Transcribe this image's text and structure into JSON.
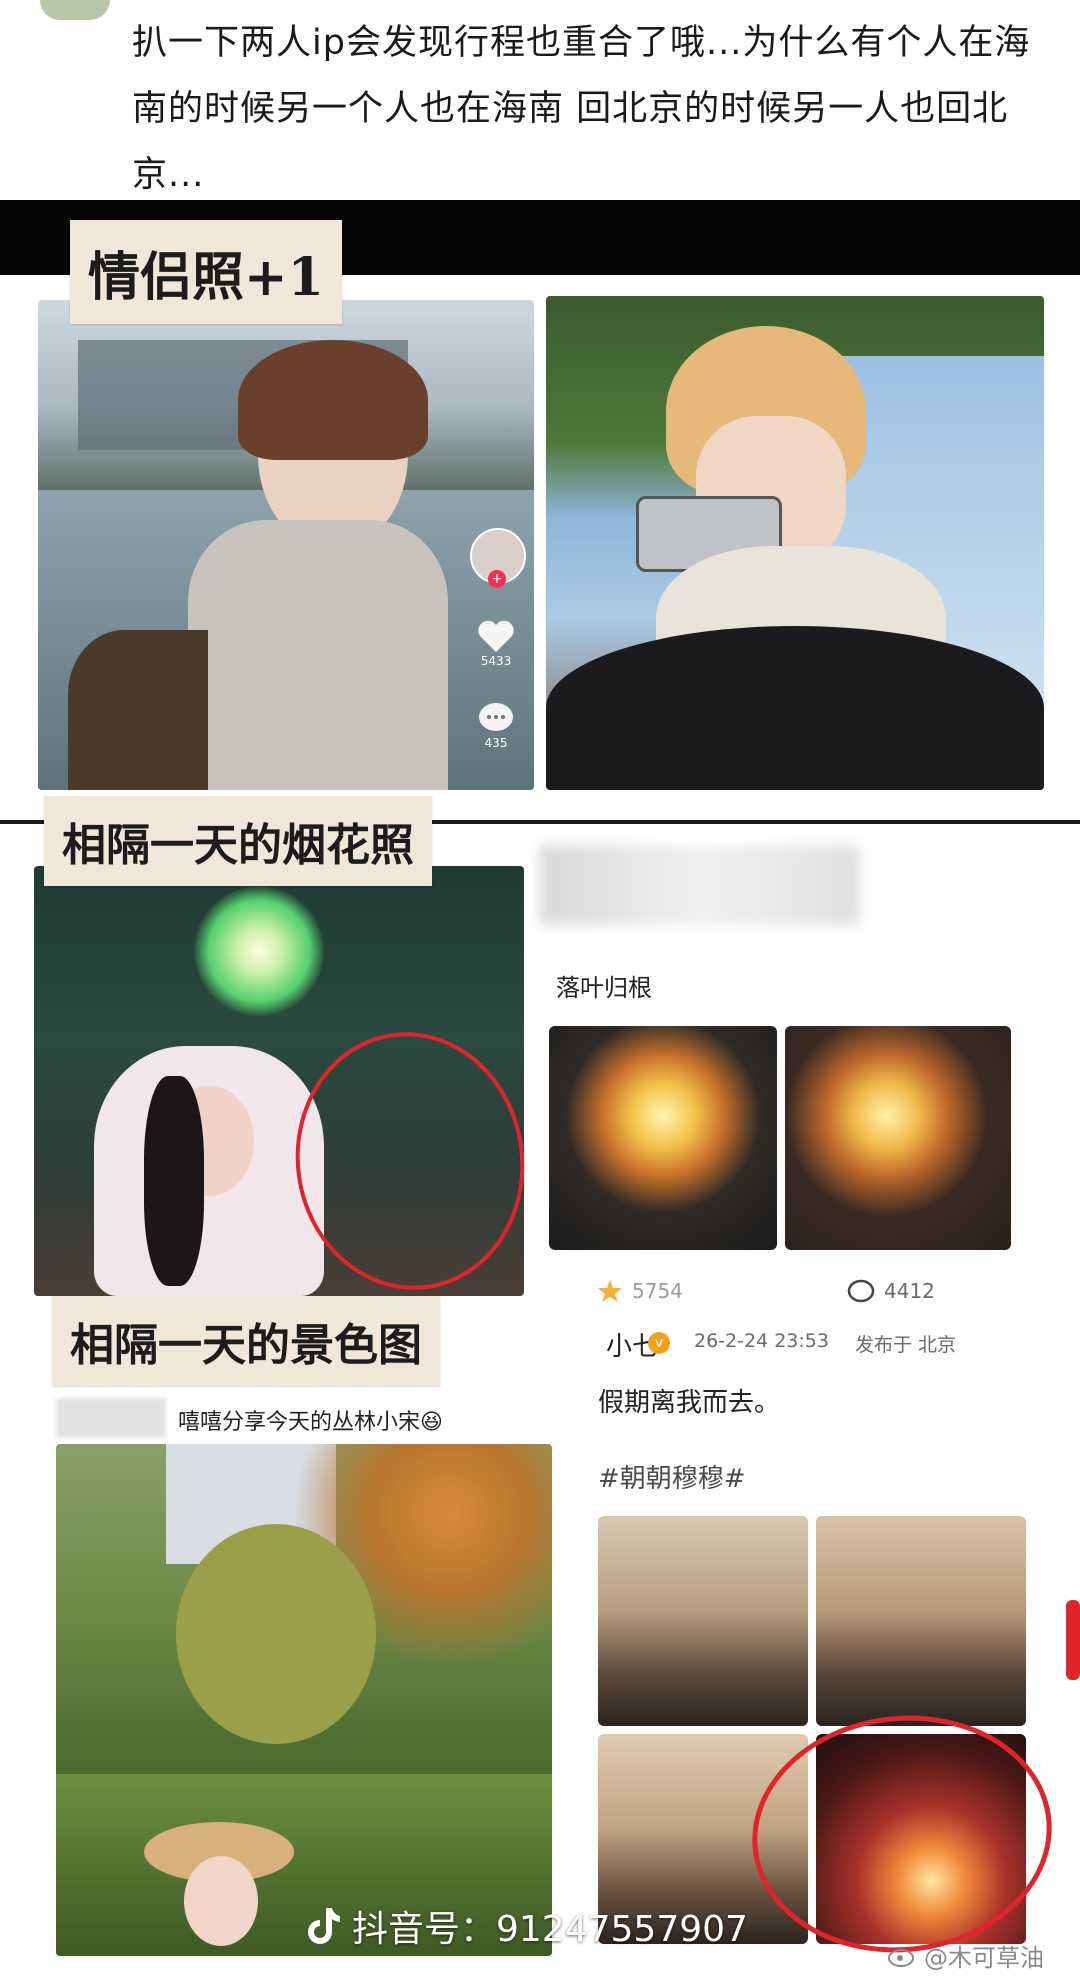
{
  "post": {
    "text": "扒一下两人ip会发现行程也重合了哦...为什么有个人在海南的时候另一个人也在海南 回北京的时候另一人也回北京..."
  },
  "sections": {
    "couple_photo": {
      "label": "情侣照+1"
    },
    "fireworks": {
      "label": "相隔一天的烟花照"
    },
    "scenery": {
      "label": "相隔一天的景色图"
    }
  },
  "tiktok_side": {
    "likes": "5433",
    "comments": "435"
  },
  "fireworks_post": {
    "caption": "落叶归根",
    "likes": "5754",
    "comments": "4412"
  },
  "scenery_left": {
    "caption": "嘻嘻分享今天的丛林小宋😆"
  },
  "scenery_right": {
    "username": "小七",
    "timestamp": "26-2-24 23:53",
    "location": "发布于 北京",
    "text": "假期离我而去。",
    "hashtag": "#朝朝穆穆#"
  },
  "watermarks": {
    "douyin": "抖音号：91247557907",
    "weibo": "@木可草油"
  },
  "colors": {
    "accent_red": "#e0242b",
    "tape_bg": "#efe7d8",
    "hashtag": "#4a4a4a"
  },
  "icons": [
    "heart-icon",
    "comment-icon",
    "avatar",
    "tiktok-logo-icon",
    "weibo-logo-icon",
    "star-icon"
  ]
}
